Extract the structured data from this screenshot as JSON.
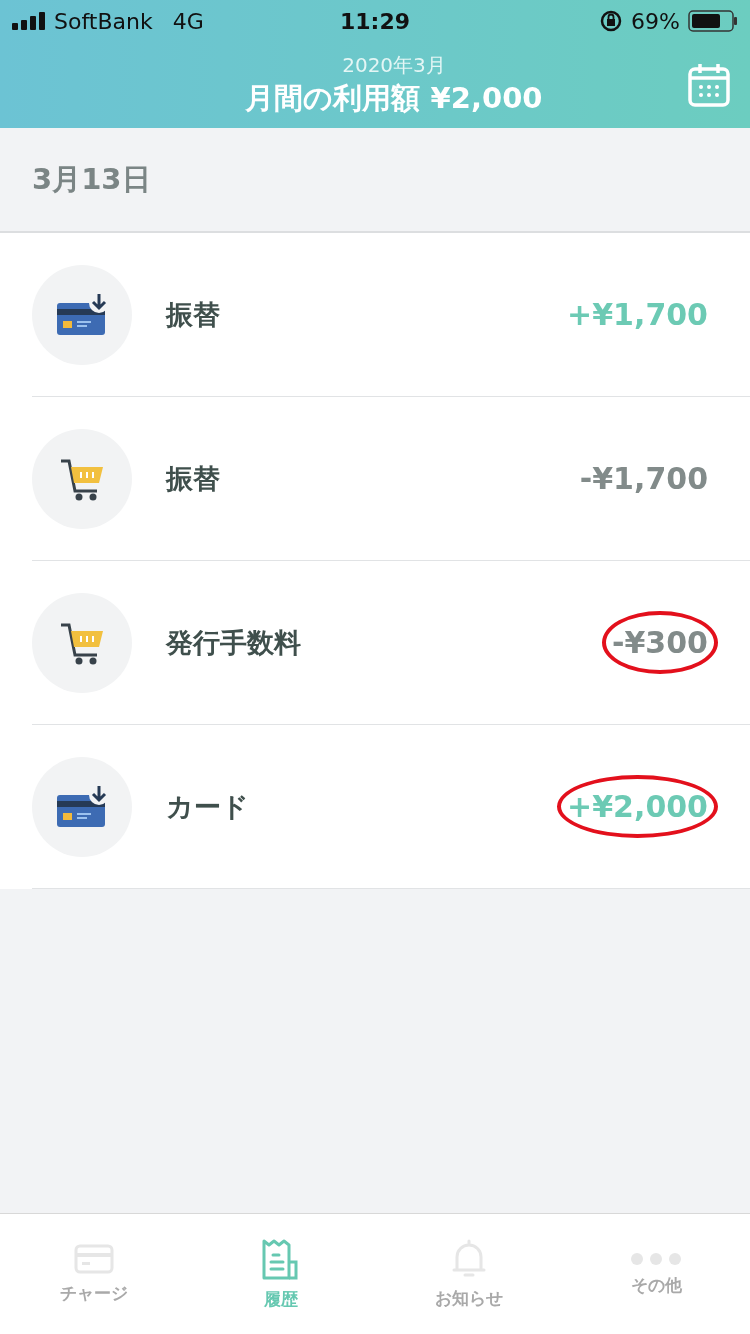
{
  "status_bar": {
    "carrier": "SoftBank",
    "network": "4G",
    "time": "11:29",
    "battery": "69%"
  },
  "header": {
    "month": "2020年3月",
    "title": "月間の利用額 ¥2,000"
  },
  "date": "3月13日",
  "transactions": [
    {
      "kind": "card",
      "label": "振替",
      "amount": "+¥1,700",
      "color": "#6ccab4",
      "circled": false
    },
    {
      "kind": "cart",
      "label": "振替",
      "amount": "-¥1,700",
      "color": "#828b8a",
      "circled": false
    },
    {
      "kind": "cart",
      "label": "発行手数料",
      "amount": "-¥300",
      "color": "#828b8a",
      "circled": true
    },
    {
      "kind": "card",
      "label": "カード",
      "amount": "+¥2,000",
      "color": "#6ccab4",
      "circled": true
    }
  ],
  "tabs": [
    {
      "kind": "card",
      "label": "チャージ",
      "selected": false
    },
    {
      "kind": "receipt",
      "label": "履歴",
      "selected": true
    },
    {
      "kind": "bell",
      "label": "お知らせ",
      "selected": false
    },
    {
      "kind": "more",
      "label": "その他",
      "selected": false
    }
  ]
}
